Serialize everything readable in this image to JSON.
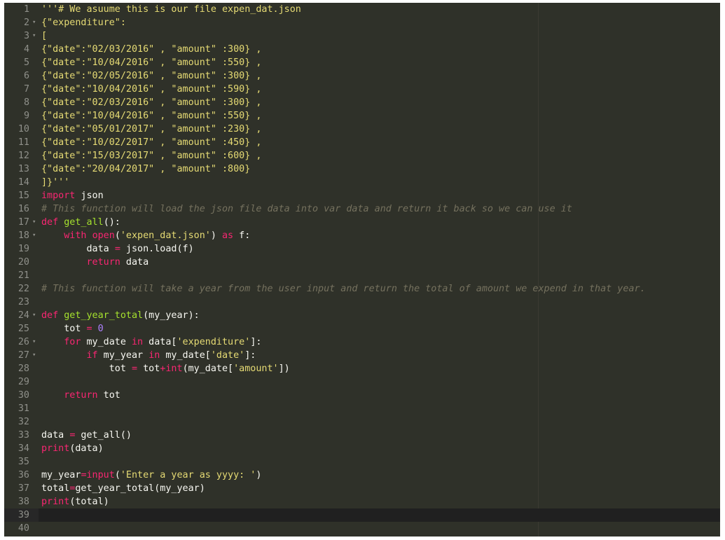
{
  "editor": {
    "theme": {
      "background": "#2f3129",
      "line_number": "#8f908a",
      "text": "#f8f8f2",
      "string": "#e6db74",
      "keyword": "#f92672",
      "comment": "#75715e"
    },
    "lines": [
      [
        [
          "str",
          "'''# We asuume this is our file expen_dat.json"
        ]
      ],
      [
        [
          "str",
          "{\"expenditure\":"
        ]
      ],
      [
        [
          "str",
          "["
        ]
      ],
      [
        [
          "str",
          "{\"date\":\"02/03/2016\" , \"amount\" :300} ,"
        ]
      ],
      [
        [
          "str",
          "{\"date\":\"10/04/2016\" , \"amount\" :550} ,"
        ]
      ],
      [
        [
          "str",
          "{\"date\":\"02/05/2016\" , \"amount\" :300} ,"
        ]
      ],
      [
        [
          "str",
          "{\"date\":\"10/04/2016\" , \"amount\" :590} ,"
        ]
      ],
      [
        [
          "str",
          "{\"date\":\"02/03/2016\" , \"amount\" :300} ,"
        ]
      ],
      [
        [
          "str",
          "{\"date\":\"10/04/2016\" , \"amount\" :550} ,"
        ]
      ],
      [
        [
          "str",
          "{\"date\":\"05/01/2017\" , \"amount\" :230} ,"
        ]
      ],
      [
        [
          "str",
          "{\"date\":\"10/02/2017\" , \"amount\" :450} ,"
        ]
      ],
      [
        [
          "str",
          "{\"date\":\"15/03/2017\" , \"amount\" :600} ,"
        ]
      ],
      [
        [
          "str",
          "{\"date\":\"20/04/2017\" , \"amount\" :800}"
        ]
      ],
      [
        [
          "str",
          "]}'''"
        ]
      ],
      [
        [
          "kw",
          "import"
        ],
        [
          "text",
          " json"
        ]
      ],
      [
        [
          "cm",
          "# This function will load the json file data into var data and return it back so we can use it"
        ]
      ],
      [
        [
          "kw",
          "def"
        ],
        [
          "text",
          " "
        ],
        [
          "fn",
          "get_all"
        ],
        [
          "text",
          "():"
        ]
      ],
      [
        [
          "text",
          "    "
        ],
        [
          "kw",
          "with"
        ],
        [
          "text",
          " "
        ],
        [
          "kw",
          "open"
        ],
        [
          "text",
          "("
        ],
        [
          "str",
          "'expen_dat.json'"
        ],
        [
          "text",
          ") "
        ],
        [
          "kw",
          "as"
        ],
        [
          "text",
          " f:"
        ]
      ],
      [
        [
          "text",
          "        data "
        ],
        [
          "op",
          "="
        ],
        [
          "text",
          " json.load(f)"
        ]
      ],
      [
        [
          "text",
          "        "
        ],
        [
          "kw",
          "return"
        ],
        [
          "text",
          " data"
        ]
      ],
      [],
      [
        [
          "cm",
          "# This function will take a year from the user input and return the total of amount we expend in that year."
        ]
      ],
      [],
      [
        [
          "kw",
          "def"
        ],
        [
          "text",
          " "
        ],
        [
          "fn",
          "get_year_total"
        ],
        [
          "text",
          "(my_year):"
        ]
      ],
      [
        [
          "text",
          "    tot "
        ],
        [
          "op",
          "="
        ],
        [
          "text",
          " "
        ],
        [
          "num",
          "0"
        ]
      ],
      [
        [
          "text",
          "    "
        ],
        [
          "kw",
          "for"
        ],
        [
          "text",
          " my_date "
        ],
        [
          "kw",
          "in"
        ],
        [
          "text",
          " data["
        ],
        [
          "str",
          "'expenditure'"
        ],
        [
          "text",
          "]:"
        ]
      ],
      [
        [
          "text",
          "        "
        ],
        [
          "kw",
          "if"
        ],
        [
          "text",
          " my_year "
        ],
        [
          "kw",
          "in"
        ],
        [
          "text",
          " my_date["
        ],
        [
          "str",
          "'date'"
        ],
        [
          "text",
          "]:"
        ]
      ],
      [
        [
          "text",
          "            tot "
        ],
        [
          "op",
          "="
        ],
        [
          "text",
          " tot"
        ],
        [
          "op",
          "+"
        ],
        [
          "kw",
          "int"
        ],
        [
          "text",
          "(my_date["
        ],
        [
          "str",
          "'amount'"
        ],
        [
          "text",
          "])"
        ]
      ],
      [],
      [
        [
          "text",
          "    "
        ],
        [
          "kw",
          "return"
        ],
        [
          "text",
          " tot"
        ]
      ],
      [],
      [],
      [
        [
          "text",
          "data "
        ],
        [
          "op",
          "="
        ],
        [
          "text",
          " get_all()"
        ]
      ],
      [
        [
          "kw",
          "print"
        ],
        [
          "text",
          "(data)"
        ]
      ],
      [],
      [
        [
          "text",
          "my_year"
        ],
        [
          "op",
          "="
        ],
        [
          "kw",
          "input"
        ],
        [
          "text",
          "("
        ],
        [
          "str",
          "'Enter a year as yyyy: '"
        ],
        [
          "text",
          ")"
        ]
      ],
      [
        [
          "text",
          "total"
        ],
        [
          "op",
          "="
        ],
        [
          "text",
          "get_year_total(my_year)"
        ]
      ],
      [
        [
          "kw",
          "print"
        ],
        [
          "text",
          "(total)"
        ]
      ],
      [],
      []
    ],
    "fold_lines": [
      2,
      3,
      17,
      18,
      24,
      26,
      27
    ],
    "fold_marker": "▾",
    "active_line": 39
  }
}
